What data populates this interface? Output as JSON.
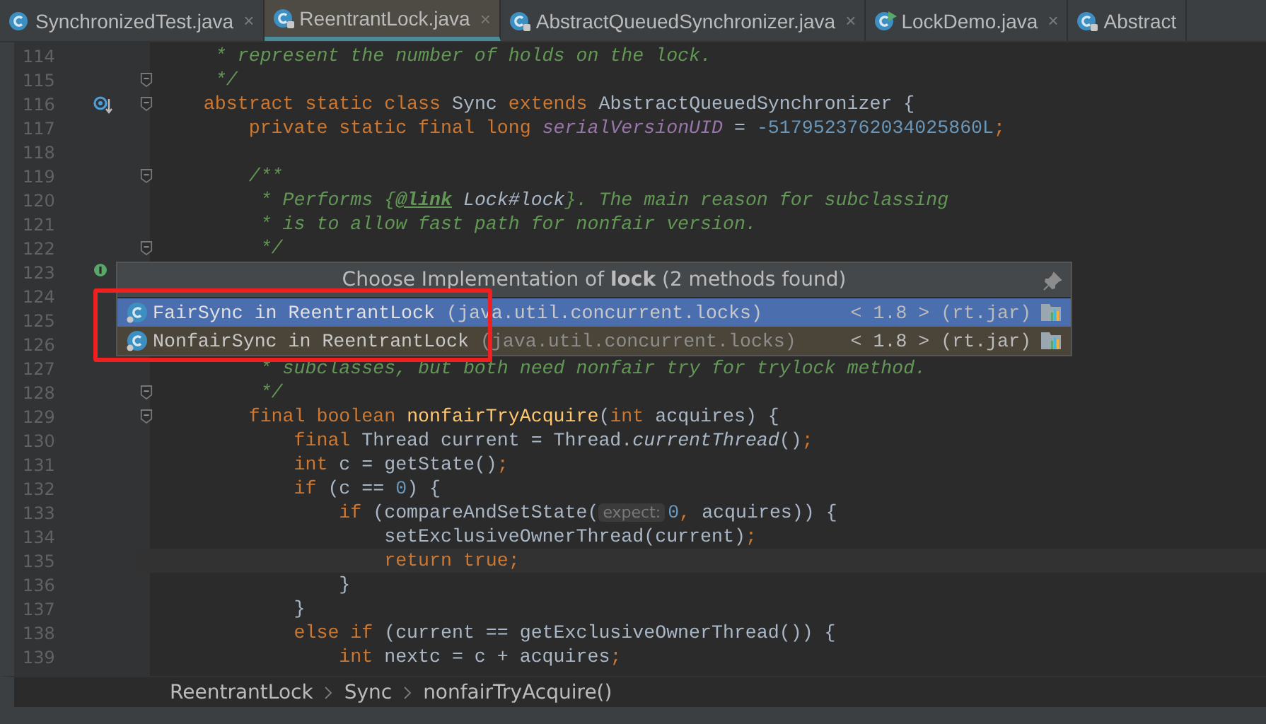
{
  "tabs": [
    {
      "label": "SynchronizedTest.java",
      "selected": false,
      "locked": false,
      "runnable": false,
      "close": "×"
    },
    {
      "label": "ReentrantLock.java",
      "selected": true,
      "locked": true,
      "runnable": false,
      "close": "×"
    },
    {
      "label": "AbstractQueuedSynchronizer.java",
      "selected": false,
      "locked": true,
      "runnable": false,
      "close": "×"
    },
    {
      "label": "LockDemo.java",
      "selected": false,
      "locked": false,
      "runnable": true,
      "close": "×"
    },
    {
      "label": "Abstract",
      "selected": false,
      "locked": true,
      "runnable": false
    }
  ],
  "editor": {
    "lines": [
      {
        "number": "114",
        "tokens": [
          {
            "kind": "doc",
            "text": "     * represent the number of holds on the lock."
          }
        ]
      },
      {
        "number": "115",
        "fold": true,
        "tokens": [
          {
            "kind": "doc",
            "text": "     */"
          }
        ]
      },
      {
        "number": "116",
        "fold": true,
        "overrides": true,
        "tokens": [
          {
            "kind": "keyword",
            "text": "    abstract static class"
          },
          {
            "kind": "plain",
            "text": " Sync "
          },
          {
            "kind": "keyword",
            "text": "extends"
          },
          {
            "kind": "plain",
            "text": " AbstractQueuedSynchronizer {"
          }
        ]
      },
      {
        "number": "117",
        "tokens": [
          {
            "kind": "keyword",
            "text": "        private static final long "
          },
          {
            "kind": "field",
            "text": "serialVersionUID"
          },
          {
            "kind": "plain",
            "text": " = "
          },
          {
            "kind": "number",
            "text": "-5179523762034025860L"
          },
          {
            "kind": "keyword",
            "text": ";"
          }
        ]
      },
      {
        "number": "118"
      },
      {
        "number": "119",
        "fold": true,
        "tokens": [
          {
            "kind": "doc",
            "text": "        /**"
          }
        ]
      },
      {
        "number": "120",
        "tokens": [
          {
            "kind": "doc",
            "text": "         * Performs {"
          },
          {
            "kind": "tag",
            "text": "@link"
          },
          {
            "kind": "ref",
            "text": " Lock#lock"
          },
          {
            "kind": "doc",
            "text": "}. The main reason for subclassing"
          }
        ]
      },
      {
        "number": "121",
        "tokens": [
          {
            "kind": "doc",
            "text": "         * is to allow fast path for nonfair version."
          }
        ]
      },
      {
        "number": "122",
        "fold": true,
        "tokens": [
          {
            "kind": "doc",
            "text": "         */"
          }
        ]
      },
      {
        "number": "123",
        "implemented": true
      },
      {
        "number": "124"
      },
      {
        "number": "125"
      },
      {
        "number": "126"
      },
      {
        "number": "127",
        "tokens": [
          {
            "kind": "doc",
            "text": "         * subclasses, but both need nonfair try for trylock method."
          }
        ]
      },
      {
        "number": "128",
        "fold": true,
        "tokens": [
          {
            "kind": "doc",
            "text": "         */"
          }
        ]
      },
      {
        "number": "129",
        "fold": true,
        "tokens": [
          {
            "kind": "keyword",
            "text": "        final boolean "
          },
          {
            "kind": "method",
            "text": "nonfairTryAcquire"
          },
          {
            "kind": "plain",
            "text": "("
          },
          {
            "kind": "keyword",
            "text": "int"
          },
          {
            "kind": "plain",
            "text": " acquires) {"
          }
        ]
      },
      {
        "number": "130",
        "tokens": [
          {
            "kind": "keyword",
            "text": "            final"
          },
          {
            "kind": "plain",
            "text": " Thread current = Thread."
          },
          {
            "kind": "italic",
            "text": "currentThread"
          },
          {
            "kind": "plain",
            "text": "()"
          },
          {
            "kind": "keyword",
            "text": ";"
          }
        ]
      },
      {
        "number": "131",
        "tokens": [
          {
            "kind": "keyword",
            "text": "            int"
          },
          {
            "kind": "plain",
            "text": " c = getState()"
          },
          {
            "kind": "keyword",
            "text": ";"
          }
        ]
      },
      {
        "number": "132",
        "tokens": [
          {
            "kind": "keyword",
            "text": "            if"
          },
          {
            "kind": "plain",
            "text": " (c == "
          },
          {
            "kind": "number",
            "text": "0"
          },
          {
            "kind": "plain",
            "text": ") {"
          }
        ]
      },
      {
        "number": "133",
        "tokens": [
          {
            "kind": "keyword",
            "text": "                if"
          },
          {
            "kind": "plain",
            "text": " (compareAndSetState("
          },
          {
            "kind": "hint",
            "text": "expect:"
          },
          {
            "kind": "number",
            "text": "0"
          },
          {
            "kind": "keyword",
            "text": ","
          },
          {
            "kind": "plain",
            "text": " acquires)) {"
          }
        ]
      },
      {
        "number": "134",
        "tokens": [
          {
            "kind": "plain",
            "text": "                    setExclusiveOwnerThread(current)"
          },
          {
            "kind": "keyword",
            "text": ";"
          }
        ]
      },
      {
        "number": "135",
        "current": true,
        "tokens": [
          {
            "kind": "keyword",
            "text": "                    return true;"
          }
        ]
      },
      {
        "number": "136",
        "tokens": [
          {
            "kind": "plain",
            "text": "                }"
          }
        ]
      },
      {
        "number": "137",
        "tokens": [
          {
            "kind": "plain",
            "text": "            }"
          }
        ]
      },
      {
        "number": "138",
        "tokens": [
          {
            "kind": "keyword",
            "text": "            else if"
          },
          {
            "kind": "plain",
            "text": " (current == getExclusiveOwnerThread()) {"
          }
        ]
      },
      {
        "number": "139",
        "tokens": [
          {
            "kind": "keyword",
            "text": "                int"
          },
          {
            "kind": "plain",
            "text": " nextc = c + acquires"
          },
          {
            "kind": "keyword",
            "text": ";"
          }
        ]
      }
    ]
  },
  "popup": {
    "title": "Choose Implementation of **lock** (2 methods found)",
    "items": [
      {
        "name": "FairSync in ReentrantLock",
        "package": "(java.util.concurrent.locks)",
        "version": "< 1.8 >",
        "jar": "(rt.jar)",
        "selected": true
      },
      {
        "name": "NonfairSync in ReentrantLock",
        "package": "(java.util.concurrent.locks)",
        "version": "< 1.8 >",
        "jar": "(rt.jar)",
        "selected": false
      }
    ]
  },
  "highlight_frame": true,
  "breadcrumbs": [
    "ReentrantLock",
    "Sync",
    "nonfairTryAcquire()"
  ]
}
